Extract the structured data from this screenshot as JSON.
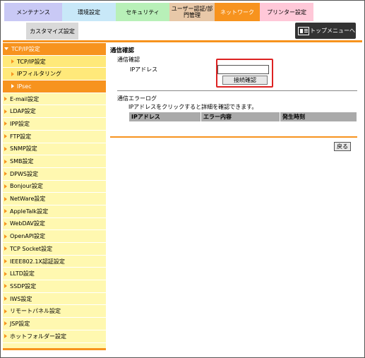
{
  "tabs": [
    {
      "label": "メンテナンス",
      "width": 82,
      "color": "#c9c9f5"
    },
    {
      "label": "環境設定",
      "width": 76,
      "color": "#c8e8f8"
    },
    {
      "label": "セキュリティ",
      "width": 76,
      "color": "#b8f0b8"
    },
    {
      "label": "ユーザー認証/部門管理",
      "width": 64,
      "color": "#e8c8a8"
    },
    {
      "label": "ネットワーク",
      "width": 64,
      "color": "#f7931e"
    },
    {
      "label": "プリンター設定",
      "width": 76,
      "color": "#ffc8d8"
    }
  ],
  "subtab": {
    "label": "カスタマイズ設定"
  },
  "topmenu": {
    "label": "トップメニューへ",
    "icon": "menu-icon"
  },
  "sidebar": {
    "head": "TCP/IP設定",
    "subs": [
      "TCP/IP設定",
      "IPフィルタリング",
      "IPsec"
    ],
    "items": [
      "E-mail設定",
      "LDAP設定",
      "IPP設定",
      "FTP設定",
      "SNMP設定",
      "SMB設定",
      "DPWS設定",
      "Bonjour設定",
      "NetWare設定",
      "AppleTalk設定",
      "WebDAV設定",
      "OpenAPI設定",
      "TCP Socket設定",
      "IEEE802.1X認証設定",
      "LLTD設定",
      "SSDP設定",
      "IWS設定",
      "リモートパネル設定",
      "JSP設定",
      "ホットフォルダー設定"
    ]
  },
  "main": {
    "title": "通信確認",
    "subtitle": "通信確認",
    "ip_label": "IPアドレス",
    "ip_value": "",
    "connect_button": "接続確認",
    "err_title": "通信エラーログ",
    "err_desc": "IPアドレスをクリックすると詳細を確認できます。",
    "columns": [
      "IPアドレス",
      "エラー内容",
      "発生時刻"
    ],
    "back_button": "戻る"
  },
  "colors": {
    "accent": "#f7931e",
    "sidebar_bg": "#fff8b0",
    "highlight": "#d22"
  }
}
